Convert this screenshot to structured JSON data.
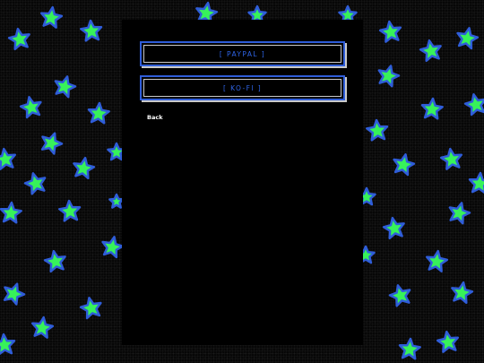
{
  "theme": {
    "background": "#070707",
    "star_fill": "#37f25a",
    "star_outline": "#2f5dd9",
    "panel": "#000000",
    "accent": "#2f64e6"
  },
  "buttons": {
    "paypal_label": "[ PAYPAL ]",
    "kofi_label": "[ KO-FI ]"
  },
  "nav": {
    "back_label": "Back"
  }
}
